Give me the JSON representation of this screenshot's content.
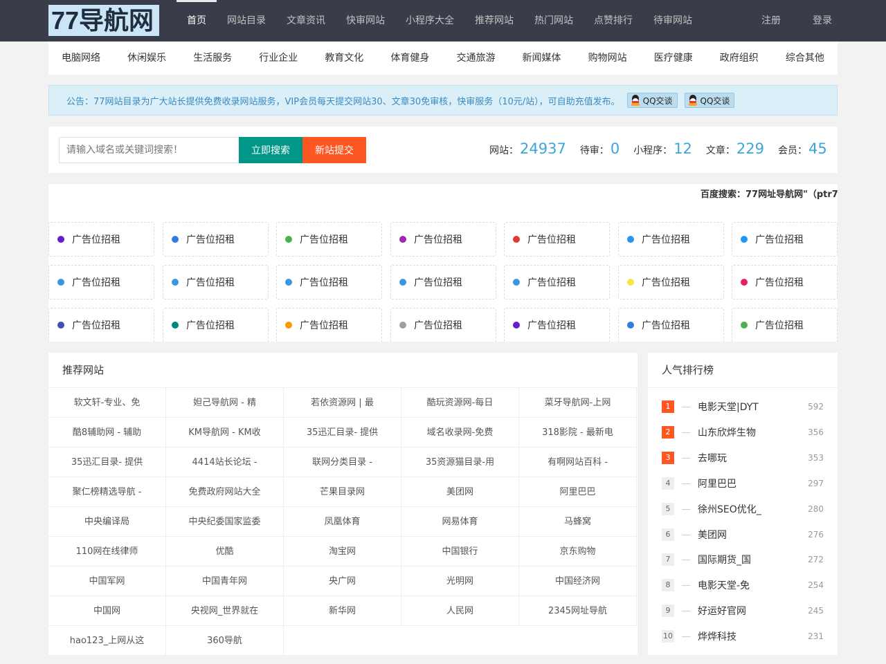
{
  "header": {
    "logo": "77导航网",
    "nav": [
      "首页",
      "网站目录",
      "文章资讯",
      "快审网站",
      "小程序大全",
      "推荐网站",
      "热门网站",
      "点赞排行",
      "待审网站"
    ],
    "nav_right": [
      "注册",
      "登录"
    ]
  },
  "categories": [
    "电脑网络",
    "休闲娱乐",
    "生活服务",
    "行业企业",
    "教育文化",
    "体育健身",
    "交通旅游",
    "新闻媒体",
    "购物网站",
    "医疗健康",
    "政府组织",
    "综合其他"
  ],
  "notice": {
    "text": "公告：77网站目录为广大站长提供免费收录网站服务，VIP会员每天提交网站30、文章30免审核，快审服务（10元/站），可自助充值发布。",
    "qq_buttons": [
      "QQ交谈",
      "QQ交谈"
    ]
  },
  "search": {
    "placeholder": "请输入域名或关键词搜索！",
    "search_button": "立即搜索",
    "submit_button": "新站提交"
  },
  "stats": [
    {
      "label": "网站：",
      "value": "24937"
    },
    {
      "label": "待审：",
      "value": "0"
    },
    {
      "label": "小程序：",
      "value": "12"
    },
    {
      "label": "文章：",
      "value": "229"
    },
    {
      "label": "会员：",
      "value": "45"
    }
  ],
  "marquee": "百度搜索：77网址导航网\"（ptr7",
  "ads": {
    "label": "广告位招租",
    "colors": [
      "#6a1bcd",
      "#2f7de1",
      "#4caf50",
      "#9c27b0",
      "#e53935",
      "#2196f3",
      "#2196f3",
      "#3b96e0",
      "#3b96e0",
      "#3b96e0",
      "#3b96e0",
      "#3b96e0",
      "#f7e83b",
      "#e91e63",
      "#3f51b5",
      "#00897b",
      "#ff9800",
      "#9e9e9e",
      "#6a1bcd",
      "#2f7de1",
      "#4caf50"
    ]
  },
  "recommended": {
    "title": "推荐网站",
    "items": [
      "软文轩-专业、免",
      "妲己导航网 - 精",
      "若依资源网 | 最",
      "酷玩资源网-每日",
      "菜牙导航网-上网",
      "酷8辅助网 - 辅助",
      "KM导航网 - KM收",
      "35迅汇目录- 提供",
      "域名收录网-免费",
      "318影院 - 最新电",
      "35迅汇目录- 提供",
      "4414站长论坛 -",
      "联网分类目录 -",
      "35资源猫目录-用",
      "有啊网站百科 -",
      "聚仁榜精选导航 -",
      "免费政府网站大全",
      "芒果目录网",
      "美团网",
      "阿里巴巴",
      "中央编译局",
      "中央纪委国家监委",
      "凤凰体育",
      "网易体育",
      "马蜂窝",
      "110网在线律师",
      "优酷",
      "淘宝网",
      "中国银行",
      "京东购物",
      "中国军网",
      "中国青年网",
      "央广网",
      "光明网",
      "中国经济网",
      "中国网",
      "央视网_世界就在",
      "新华网",
      "人民网",
      "2345网址导航",
      "hao123_上网从这",
      "360导航"
    ]
  },
  "ranking": {
    "title": "人气排行榜",
    "items": [
      {
        "no": "1",
        "name": "电影天堂|DYT",
        "count": "592"
      },
      {
        "no": "2",
        "name": "山东欣烨生物",
        "count": "356"
      },
      {
        "no": "3",
        "name": "去哪玩",
        "count": "353"
      },
      {
        "no": "4",
        "name": "阿里巴巴",
        "count": "297"
      },
      {
        "no": "5",
        "name": "徐州SEO优化_",
        "count": "280"
      },
      {
        "no": "6",
        "name": "美团网",
        "count": "276"
      },
      {
        "no": "7",
        "name": "国际期货_国",
        "count": "272"
      },
      {
        "no": "8",
        "name": "电影天堂-免",
        "count": "254"
      },
      {
        "no": "9",
        "name": "好运好官网",
        "count": "245"
      },
      {
        "no": "10",
        "name": "烨烨科技",
        "count": "231"
      }
    ]
  }
}
